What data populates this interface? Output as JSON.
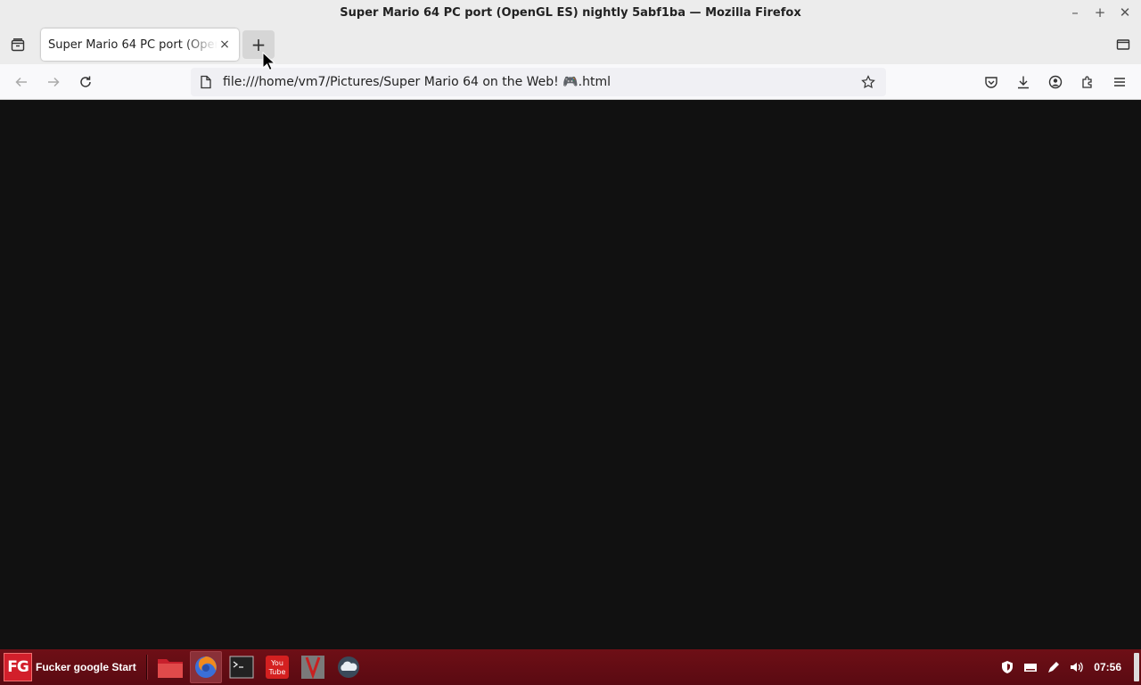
{
  "window": {
    "title": "Super Mario 64 PC port (OpenGL ES) nightly 5abf1ba — Mozilla Firefox",
    "controls": [
      "minimize",
      "maximize",
      "close"
    ]
  },
  "tabs": [
    {
      "title": "Super Mario 64 PC port (OpenGL ES) nightly 5abf1ba",
      "close_label": "×",
      "active": true
    }
  ],
  "newtab_label": "+",
  "navbar": {
    "url": "file:///home/vm7/Pictures/Super Mario 64 on the Web! 🎮.html"
  },
  "taskbar": {
    "start_logo": "FG",
    "start_label": "Fucker google Start",
    "launchers": [
      "folder-icon",
      "firefox-icon",
      "terminal-icon",
      "youtube-icon",
      "app-icon",
      "cloud-icon"
    ],
    "tray": [
      "shield-icon",
      "keyboard-icon",
      "pen-icon",
      "volume-icon"
    ],
    "clock": "07:56"
  },
  "colors": {
    "content_bg": "#111111",
    "taskbar": "#6e0f16",
    "chrome": "#ececec"
  }
}
